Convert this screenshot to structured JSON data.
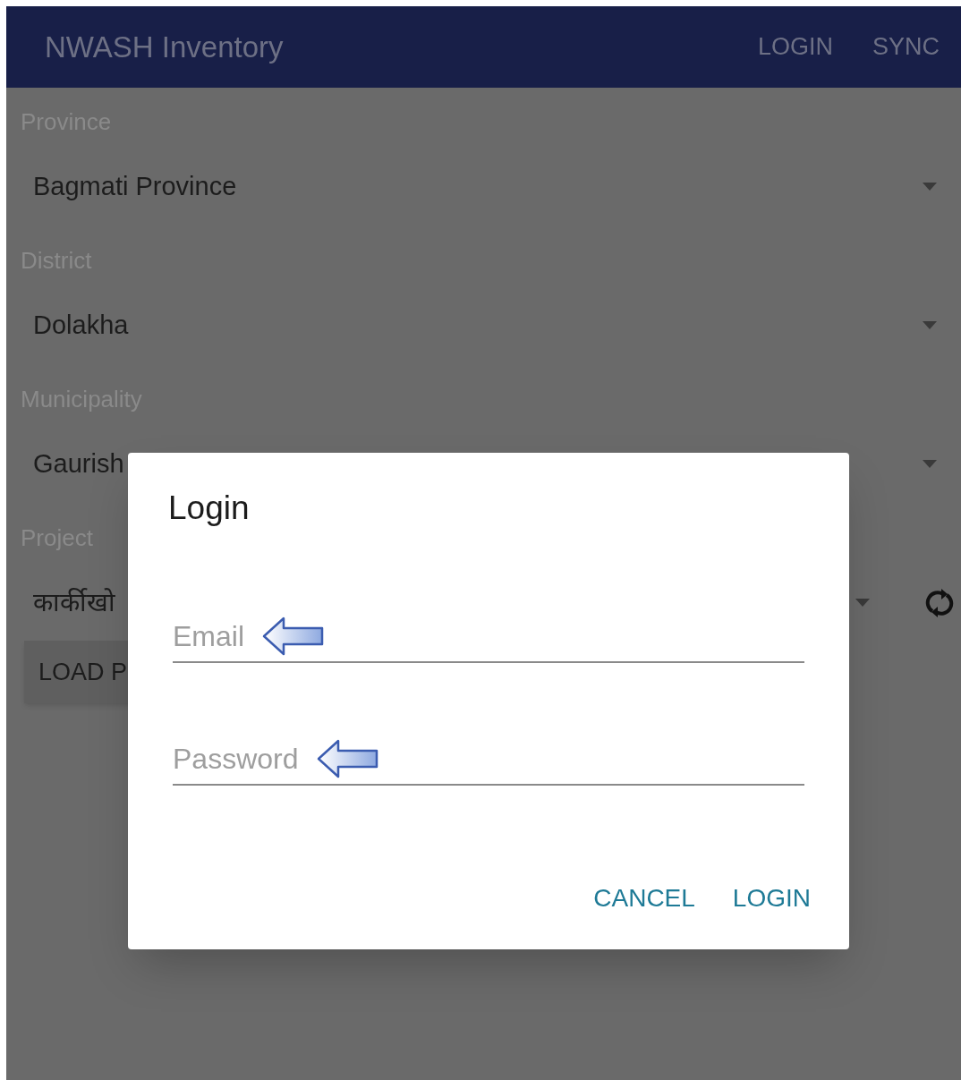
{
  "app_bar": {
    "title": "NWASH Inventory",
    "actions": [
      "LOGIN",
      "SYNC"
    ]
  },
  "form": {
    "fields": [
      {
        "label": "Province",
        "value": "Bagmati Province",
        "kind": "select"
      },
      {
        "label": "District",
        "value": "Dolakha",
        "kind": "select"
      },
      {
        "label": "Municipality",
        "value": "Gaurish",
        "kind": "select"
      },
      {
        "label": "Project",
        "value": "कार्कीखो",
        "kind": "select_with_sync"
      }
    ],
    "load_button": "LOAD P"
  },
  "dialog": {
    "title": "Login",
    "fields": [
      {
        "placeholder": "Email"
      },
      {
        "placeholder": "Password"
      }
    ],
    "buttons": [
      "CANCEL",
      "LOGIN"
    ]
  }
}
